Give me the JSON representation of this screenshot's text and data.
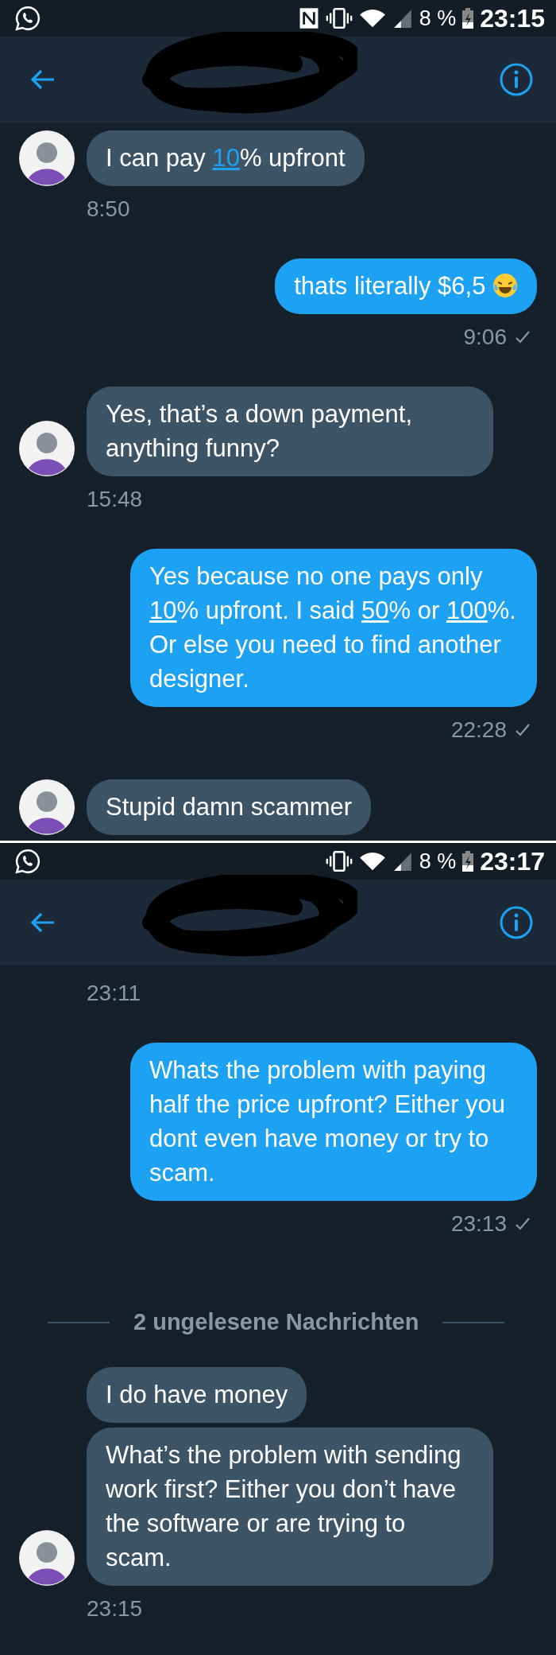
{
  "screens": [
    {
      "status_bar": {
        "nfc": true,
        "battery": "8 %",
        "time": "23:15"
      },
      "messages": [
        {
          "kind": "received",
          "avatar": true,
          "parts": [
            {
              "kind": "text",
              "text": "I can pay "
            },
            {
              "kind": "link",
              "text": "10"
            },
            {
              "kind": "text",
              "text": "% upfront"
            }
          ]
        },
        {
          "kind": "time",
          "outgoing": false,
          "text": "8:50",
          "tick": false
        },
        {
          "kind": "sent",
          "parts": [
            {
              "kind": "text",
              "text": "thats literally $6,5 "
            },
            {
              "kind": "emoji"
            }
          ]
        },
        {
          "kind": "time",
          "outgoing": true,
          "text": "9:06",
          "tick": true
        },
        {
          "kind": "received",
          "avatar": true,
          "parts": [
            {
              "kind": "text",
              "text": "Yes, that’s a down payment, anything funny?"
            }
          ]
        },
        {
          "kind": "time",
          "outgoing": false,
          "text": "15:48",
          "tick": false
        },
        {
          "kind": "sent",
          "parts": [
            {
              "kind": "text",
              "text": "Yes because no one pays only "
            },
            {
              "kind": "link",
              "text": "10"
            },
            {
              "kind": "text",
              "text": "% upfront. I said "
            },
            {
              "kind": "link",
              "text": "50"
            },
            {
              "kind": "text",
              "text": "% or "
            },
            {
              "kind": "link",
              "text": "100"
            },
            {
              "kind": "text",
              "text": "%. Or else you need to find another designer."
            }
          ]
        },
        {
          "kind": "time",
          "outgoing": true,
          "text": "22:28",
          "tick": true
        },
        {
          "kind": "received",
          "avatar": true,
          "parts": [
            {
              "kind": "text",
              "text": "Stupid damn scammer"
            }
          ]
        }
      ]
    },
    {
      "status_bar": {
        "nfc": false,
        "battery": "8 %",
        "time": "23:17"
      },
      "messages": [
        {
          "kind": "time",
          "outgoing": false,
          "text": "23:11",
          "tick": false
        },
        {
          "kind": "sent",
          "parts": [
            {
              "kind": "text",
              "text": "Whats the problem with paying half the price upfront? Either you dont even have money or try to scam."
            }
          ]
        },
        {
          "kind": "time",
          "outgoing": true,
          "text": "23:13",
          "tick": true
        },
        {
          "kind": "divider",
          "text": "2 ungelesene Nachrichten"
        },
        {
          "kind": "received",
          "avatar": false,
          "parts": [
            {
              "kind": "text",
              "text": "I do have money"
            }
          ]
        },
        {
          "kind": "received",
          "avatar": true,
          "parts": [
            {
              "kind": "text",
              "text": "What’s the problem with sending work first? Either you don’t have the software or are trying to scam."
            }
          ]
        },
        {
          "kind": "time",
          "outgoing": false,
          "text": "23:15",
          "tick": false
        }
      ]
    }
  ]
}
